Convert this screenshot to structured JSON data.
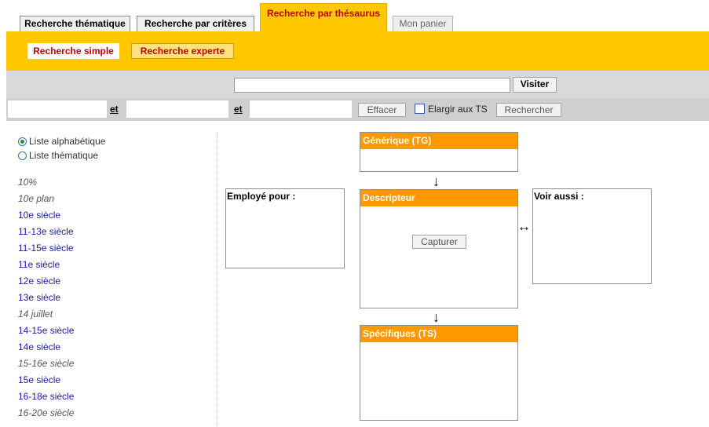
{
  "tabs": {
    "thematique": "Recherche thématique",
    "criteres": "Recherche par critères",
    "thesaurus": "Recherche par thésaurus",
    "panier": "Mon panier"
  },
  "subtabs": {
    "simple": "Recherche simple",
    "experte": "Recherche experte"
  },
  "search": {
    "value": "",
    "visit_label": "Visiter"
  },
  "criteria": {
    "et1": "et",
    "et2": "et",
    "effacer_label": "Effacer",
    "elargir_label": "Elargir aux TS",
    "elargir_checked": false,
    "rechercher_label": "Rechercher"
  },
  "list_mode": {
    "alphabetique": "Liste alphabétique",
    "thematique": "Liste thématique",
    "selected": "alphabetique"
  },
  "terms": [
    {
      "label": "10%",
      "link": false
    },
    {
      "label": "10e plan",
      "link": false
    },
    {
      "label": "10e siècle",
      "link": true
    },
    {
      "label": "11-13e siècle",
      "link": true
    },
    {
      "label": "11-15e siècle",
      "link": true
    },
    {
      "label": "11e siècle",
      "link": true
    },
    {
      "label": "12e siècle",
      "link": true
    },
    {
      "label": "13e siècle",
      "link": true
    },
    {
      "label": "14 juillet",
      "link": false
    },
    {
      "label": "14-15e siècle",
      "link": true
    },
    {
      "label": "14e siècle",
      "link": true
    },
    {
      "label": "15-16e siècle",
      "link": false
    },
    {
      "label": "15e siècle",
      "link": true
    },
    {
      "label": "16-18e siècle",
      "link": true
    },
    {
      "label": "16-20e siècle",
      "link": false
    }
  ],
  "thesaurus": {
    "generique": "Générique (TG)",
    "employe_pour": "Employé pour :",
    "descripteur": "Descripteur",
    "capturer_label": "Capturer",
    "voir_aussi": "Voir aussi :",
    "specifiques": "Spécifiques (TS)",
    "arrow_down": "↓",
    "arrow_both": "↔"
  },
  "colors": {
    "yellow": "#ffc800",
    "orange_header": "#ff9900",
    "active_tab_text": "#c00000",
    "link": "#1a1aa6"
  }
}
